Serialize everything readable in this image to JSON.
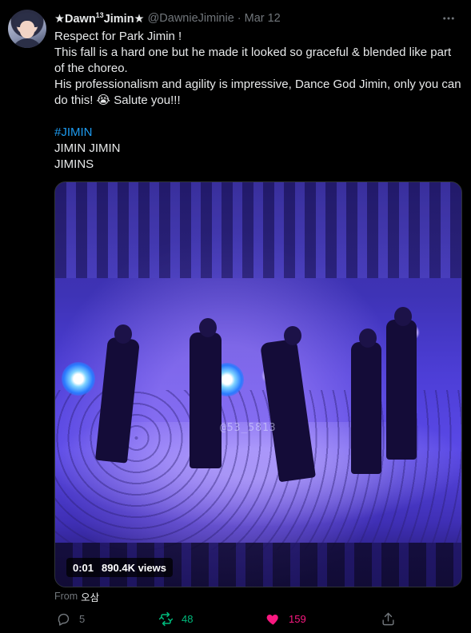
{
  "tweet": {
    "author_name": "★Dawn",
    "author_name_sup": "13",
    "author_name_tail": "Jimin★",
    "handle": "@DawnieJiminie",
    "separator": "·",
    "date": "Mar 12",
    "more_icon": "more-horizontal-icon",
    "text_lines": [
      "Respect for Park Jimin !",
      "This fall is a hard one but he made it looked so graceful & blended like part of the choreo.",
      "His professionalism and agility is impressive, Dance God Jimin, only you can do this! 😭 Salute you!!!"
    ],
    "hashtag": "#JIMIN",
    "extra_lines": [
      "JIMIN JIMIN",
      "JIMINS"
    ]
  },
  "media": {
    "watermark": "@53_5813",
    "time": "0:01",
    "views": "890.4K views"
  },
  "source": {
    "prefix": "From",
    "name": "오삼"
  },
  "actions": {
    "reply_count": "5",
    "retweet_count": "48",
    "like_count": "159"
  },
  "colors": {
    "background": "#000000",
    "text": "#e7e9ea",
    "muted": "#71767b",
    "link": "#1d9bf0",
    "retweet": "#00ba7c",
    "like": "#f91880"
  }
}
